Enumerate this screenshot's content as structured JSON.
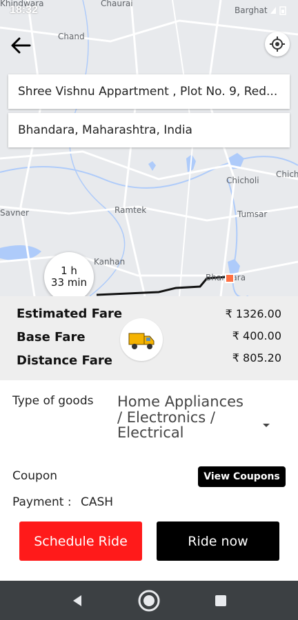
{
  "status_bar": {
    "time": "18:32"
  },
  "map": {
    "places": [
      "Khindwara",
      "Chaurai",
      "Barghat",
      "Chand",
      "Chicholi",
      "Chich",
      "Savner",
      "Ramtek",
      "Tumsar",
      "Kanhan",
      "Bhandara"
    ]
  },
  "route": {
    "pickup": "Shree Vishnu Appartment , Plot No. 9, Red...",
    "drop": "Bhandara, Maharashtra, India",
    "eta_line1": "1 h",
    "eta_line2": "33 min"
  },
  "fare": {
    "estimated_label": "Estimated Fare",
    "estimated_value": "₹ 1326.00",
    "base_label": "Base Fare",
    "base_value": "₹ 400.00",
    "distance_label": "Distance Fare",
    "distance_value": "₹ 805.20"
  },
  "form": {
    "goods_label": "Type of goods",
    "goods_value": "Home Appliances / Electronics / Electrical",
    "coupon_label": "Coupon",
    "view_coupons": "View Coupons",
    "payment_label": "Payment :",
    "payment_value": "CASH"
  },
  "actions": {
    "schedule": "Schedule Ride",
    "ride_now": "Ride now"
  },
  "colors": {
    "accent_red": "#ff1a1a",
    "dark": "#000000",
    "marker": "#ff7043"
  },
  "icons": [
    "back-arrow-icon",
    "my-location-icon",
    "truck-icon",
    "dropdown-icon",
    "nav-back-icon",
    "nav-home-icon",
    "nav-recents-icon"
  ]
}
